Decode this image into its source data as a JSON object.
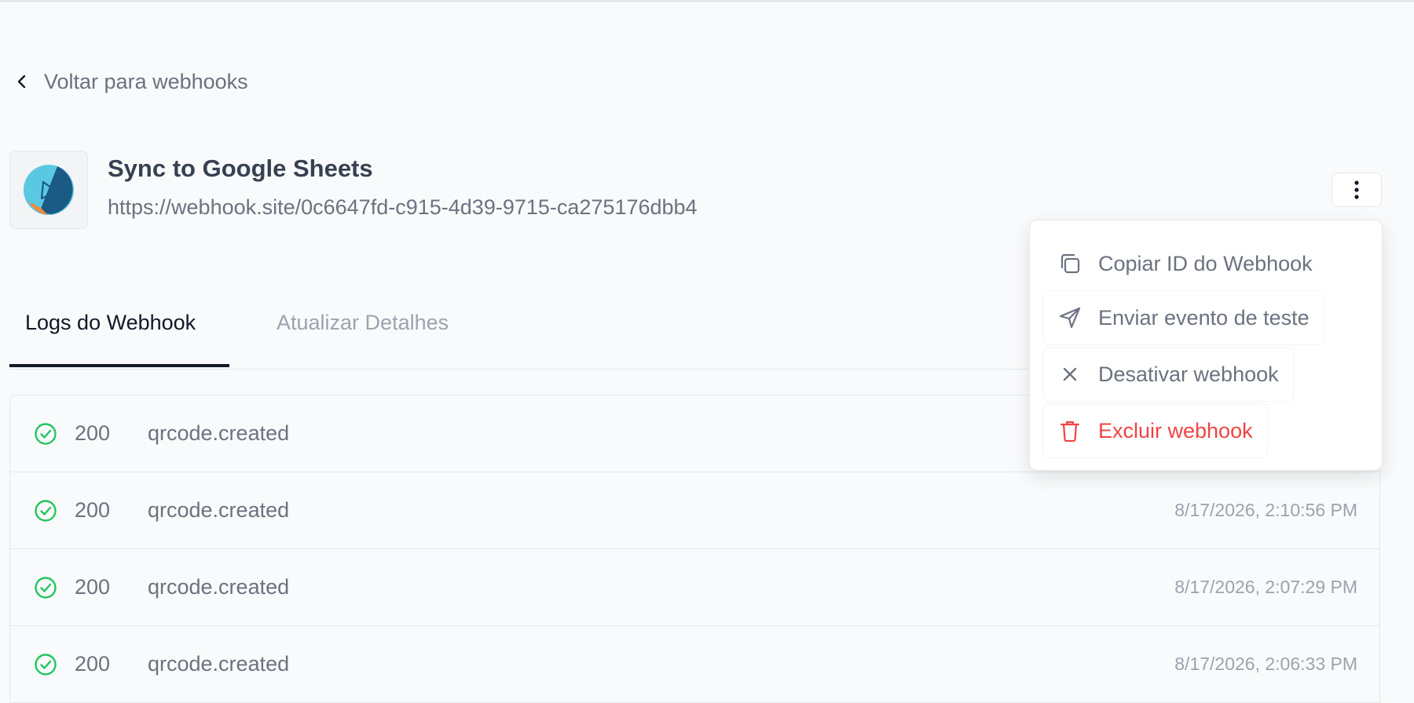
{
  "back_link": {
    "label": "Voltar para webhooks",
    "icon": "chevron-left-icon"
  },
  "webhook": {
    "name": "Sync to Google Sheets",
    "url": "https://webhook.site/0c6647fd-c915-4d39-9715-ca275176dbb4",
    "logo_icon": "google-sheets-sync-logo"
  },
  "tabs": [
    {
      "label": "Logs do Webhook",
      "active": true
    },
    {
      "label": "Atualizar Detalhes",
      "active": false
    }
  ],
  "logs": [
    {
      "status": "200",
      "event": "qrcode.created",
      "time": ""
    },
    {
      "status": "200",
      "event": "qrcode.created",
      "time": "8/17/2026, 2:10:56 PM"
    },
    {
      "status": "200",
      "event": "qrcode.created",
      "time": "8/17/2026, 2:07:29 PM"
    },
    {
      "status": "200",
      "event": "qrcode.created",
      "time": "8/17/2026, 2:06:33 PM"
    }
  ],
  "menu": {
    "items": [
      {
        "label": "Copiar ID do Webhook",
        "icon": "copy-icon"
      },
      {
        "label": "Enviar evento de teste",
        "icon": "send-icon"
      },
      {
        "label": "Desativar webhook",
        "icon": "close-icon"
      },
      {
        "label": "Excluir webhook",
        "icon": "trash-icon"
      }
    ]
  },
  "colors": {
    "success": "#22c55e",
    "danger": "#ef4444",
    "logo_light": "#5bc8e2",
    "logo_dark": "#1a5a85",
    "logo_accent": "#f58a3c"
  }
}
